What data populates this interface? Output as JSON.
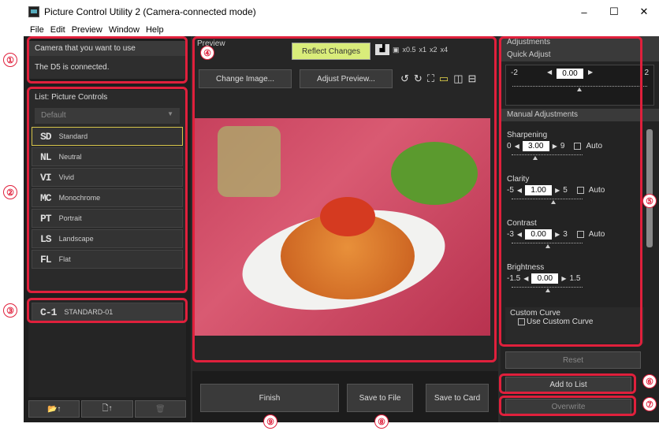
{
  "window": {
    "title": "Picture Control Utility 2 (Camera-connected mode)",
    "min": "–",
    "max": "☐",
    "close": "✕"
  },
  "menu": [
    "File",
    "Edit",
    "Preview",
    "Window",
    "Help"
  ],
  "camera": {
    "header": "Camera that you want to use",
    "status": "The D5 is connected."
  },
  "list": {
    "header": "List: Picture Controls",
    "dropdown": "Default",
    "items": [
      {
        "code": "SD",
        "label": "Standard"
      },
      {
        "code": "NL",
        "label": "Neutral"
      },
      {
        "code": "VI",
        "label": "Vivid"
      },
      {
        "code": "MC",
        "label": "Monochrome"
      },
      {
        "code": "PT",
        "label": "Portrait"
      },
      {
        "code": "LS",
        "label": "Landscape"
      },
      {
        "code": "FL",
        "label": "Flat"
      }
    ]
  },
  "custom": {
    "code": "C-1",
    "label": "STANDARD-01"
  },
  "preview": {
    "header": "Preview",
    "reflect": "Reflect Changes",
    "change_image": "Change Image...",
    "adjust_preview": "Adjust Preview...",
    "zoom": [
      "x0.5",
      "x1",
      "x2",
      "x4"
    ]
  },
  "actions": {
    "finish": "Finish",
    "save_file": "Save to File",
    "save_card": "Save to Card"
  },
  "adjustments": {
    "header": "Adjustments",
    "quick": "Quick Adjust",
    "quick_min": "-2",
    "quick_val": "0.00",
    "quick_max": "2",
    "manual": "Manual Adjustments",
    "params": [
      {
        "name": "Sharpening",
        "min": "0",
        "val": "3.00",
        "max": "9",
        "auto": "Auto"
      },
      {
        "name": "Clarity",
        "min": "-5",
        "val": "1.00",
        "max": "5",
        "auto": "Auto"
      },
      {
        "name": "Contrast",
        "min": "-3",
        "val": "0.00",
        "max": "3",
        "auto": "Auto"
      },
      {
        "name": "Brightness",
        "min": "-1.5",
        "val": "0.00",
        "max": "1.5",
        "auto": ""
      }
    ],
    "curve": "Custom Curve",
    "use_curve": "Use Custom Curve",
    "reset": "Reset",
    "add": "Add to List",
    "overwrite": "Overwrite"
  },
  "callouts": [
    "①",
    "②",
    "③",
    "④",
    "⑤",
    "⑥",
    "⑦",
    "⑧",
    "⑨"
  ]
}
